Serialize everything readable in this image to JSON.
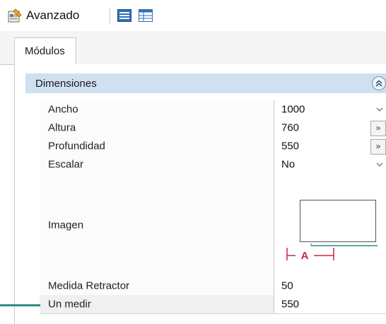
{
  "toolbar": {
    "label": "Avanzado",
    "icons": [
      "advanced-edit-icon",
      "list-view-icon",
      "table-view-icon"
    ]
  },
  "tabs": [
    {
      "label": "Módulos",
      "active": true
    }
  ],
  "group": {
    "label": "Dimensiones",
    "expanded": true
  },
  "properties": [
    {
      "name": "Ancho",
      "value": "1000",
      "control": "dropdown"
    },
    {
      "name": "Altura",
      "value": "760",
      "control": "ellipsis-button",
      "button_label": "»"
    },
    {
      "name": "Profundidad",
      "value": "550",
      "control": "ellipsis-button",
      "button_label": "»"
    },
    {
      "name": "Escalar",
      "value": "No",
      "control": "dropdown"
    },
    {
      "name": "Imagen",
      "value": "",
      "control": "image-preview",
      "image_label": "A"
    },
    {
      "name": "Medida Retractor",
      "value": "50",
      "control": "text"
    },
    {
      "name": "Un medir",
      "value": "550",
      "control": "text"
    }
  ],
  "colors": {
    "group_header": "#cfe0f1",
    "leader_line": "#2a8f84",
    "measure_red": "#d0263a",
    "grid_line": "#d4d4d4"
  }
}
